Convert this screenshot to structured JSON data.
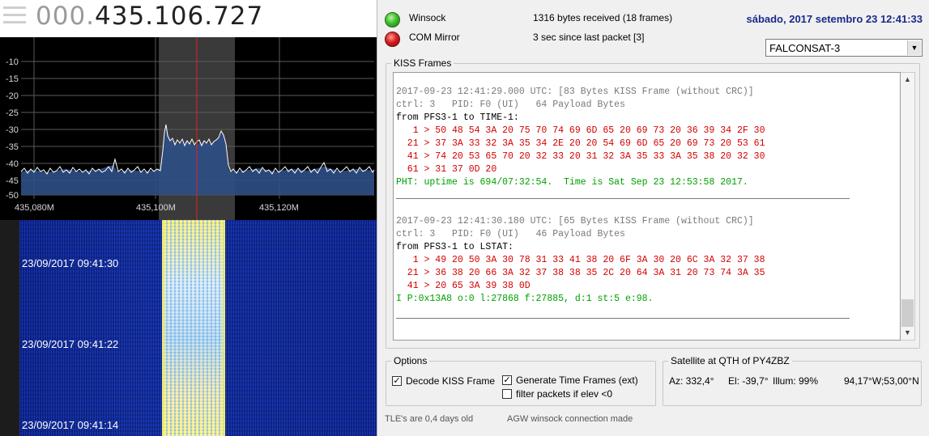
{
  "sdr": {
    "frequency": {
      "dim": "000.",
      "main": "435.106.727"
    },
    "spectrum": {
      "y_ticks": [
        "-10",
        "-15",
        "-20",
        "-25",
        "-30",
        "-35",
        "-40",
        "-45",
        "-50"
      ],
      "x_ticks": [
        "435,080M",
        "435,100M",
        "435,120M"
      ]
    },
    "waterfall": {
      "timestamps": [
        "23/09/2017 09:41:30",
        "23/09/2017 09:41:22",
        "23/09/2017 09:41:14"
      ]
    }
  },
  "status": {
    "winsock_label": "Winsock",
    "winsock_info": "1316 bytes received (18 frames)",
    "com_label": "COM Mirror",
    "com_info": "3 sec since last packet [3]",
    "datetime": "sábado, 2017 setembro 23  12:41:33"
  },
  "satellite_select": {
    "value": "FALCONSAT-3"
  },
  "kiss": {
    "title": "KISS Frames",
    "frames": [
      {
        "header": "2017-09-23 12:41:29.000 UTC: [83 Bytes KISS Frame (without CRC)]",
        "ctrl": "ctrl: 3   PID: F0 (UI)   64 Payload Bytes",
        "route": "from PFS3-1 to TIME-1:",
        "hex": [
          "   1 > 50 48 54 3A 20 75 70 74 69 6D 65 20 69 73 20 36 39 34 2F 30",
          "  21 > 37 3A 33 32 3A 35 34 2E 20 20 54 69 6D 65 20 69 73 20 53 61",
          "  41 > 74 20 53 65 70 20 32 33 20 31 32 3A 35 33 3A 35 38 20 32 30",
          "  61 > 31 37 0D 20"
        ],
        "decoded": "PHT: uptime is 694/07:32:54.  Time is Sat Sep 23 12:53:58 2017."
      },
      {
        "header": "2017-09-23 12:41:30.180 UTC: [65 Bytes KISS Frame (without CRC)]",
        "ctrl": "ctrl: 3   PID: F0 (UI)   46 Payload Bytes",
        "route": "from PFS3-1 to LSTAT:",
        "hex": [
          "   1 > 49 20 50 3A 30 78 31 33 41 38 20 6F 3A 30 20 6C 3A 32 37 38",
          "  21 > 36 38 20 66 3A 32 37 38 38 35 2C 20 64 3A 31 20 73 74 3A 35",
          "  41 > 20 65 3A 39 38 0D"
        ],
        "decoded": "I P:0x13A8 o:0 l:27868 f:27885, d:1 st:5 e:98."
      }
    ]
  },
  "options": {
    "title": "Options",
    "decode_kiss": {
      "label": "Decode KISS Frame",
      "checked": true
    },
    "generate_time": {
      "label": "Generate Time Frames (ext)",
      "checked": true
    },
    "filter_elev": {
      "label": "filter packets if elev <0",
      "checked": false
    }
  },
  "satellite": {
    "title": "Satellite at QTH of PY4ZBZ",
    "az": "Az: 332,4°",
    "el": "El: -39,7°",
    "illum": "Illum: 99%",
    "position": "94,17°W;53,00°N"
  },
  "footer": {
    "tle": "TLE's are 0,4 days old",
    "agw": "AGW winsock connection made"
  },
  "colors": {
    "datetime": "#1b2a8a",
    "hex_red": "#d40000",
    "decoded_green": "#00a000",
    "header_gray": "#7a7a7a"
  }
}
